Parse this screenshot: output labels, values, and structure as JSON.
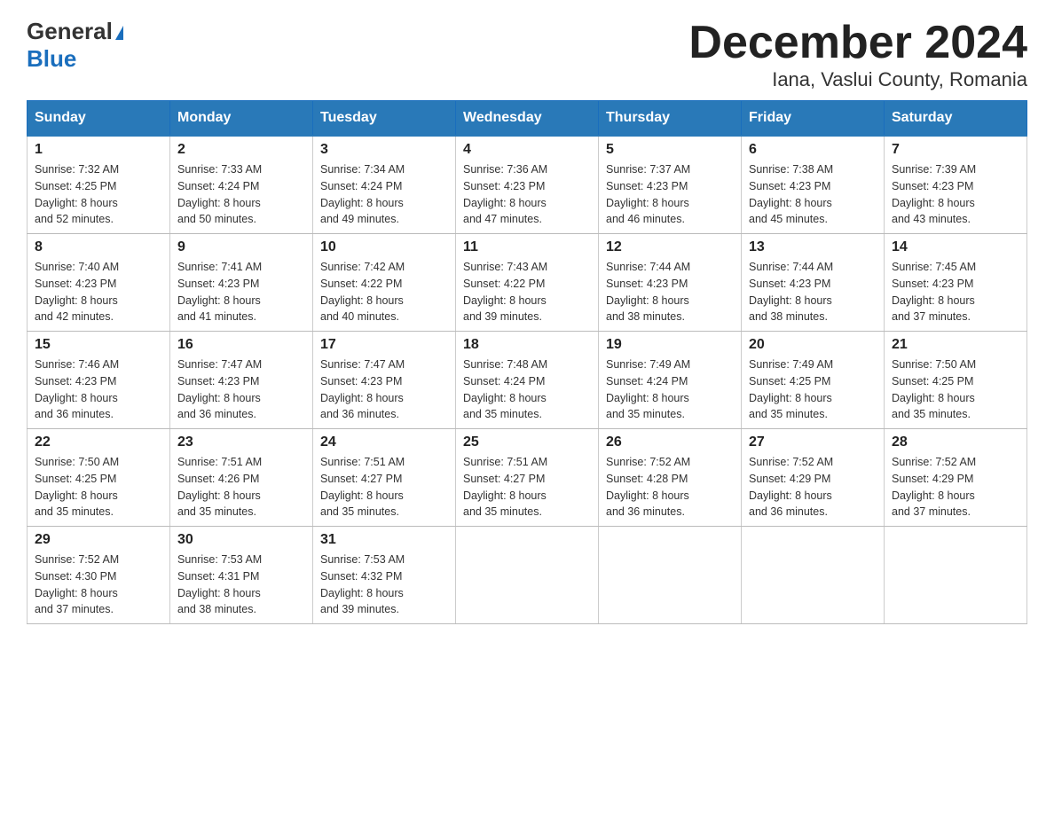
{
  "logo": {
    "line1": "General",
    "triangle": true,
    "line2": "Blue"
  },
  "title": "December 2024",
  "subtitle": "Iana, Vaslui County, Romania",
  "days_of_week": [
    "Sunday",
    "Monday",
    "Tuesday",
    "Wednesday",
    "Thursday",
    "Friday",
    "Saturday"
  ],
  "weeks": [
    [
      {
        "day": "1",
        "sunrise": "7:32 AM",
        "sunset": "4:25 PM",
        "daylight": "8 hours and 52 minutes."
      },
      {
        "day": "2",
        "sunrise": "7:33 AM",
        "sunset": "4:24 PM",
        "daylight": "8 hours and 50 minutes."
      },
      {
        "day": "3",
        "sunrise": "7:34 AM",
        "sunset": "4:24 PM",
        "daylight": "8 hours and 49 minutes."
      },
      {
        "day": "4",
        "sunrise": "7:36 AM",
        "sunset": "4:23 PM",
        "daylight": "8 hours and 47 minutes."
      },
      {
        "day": "5",
        "sunrise": "7:37 AM",
        "sunset": "4:23 PM",
        "daylight": "8 hours and 46 minutes."
      },
      {
        "day": "6",
        "sunrise": "7:38 AM",
        "sunset": "4:23 PM",
        "daylight": "8 hours and 45 minutes."
      },
      {
        "day": "7",
        "sunrise": "7:39 AM",
        "sunset": "4:23 PM",
        "daylight": "8 hours and 43 minutes."
      }
    ],
    [
      {
        "day": "8",
        "sunrise": "7:40 AM",
        "sunset": "4:23 PM",
        "daylight": "8 hours and 42 minutes."
      },
      {
        "day": "9",
        "sunrise": "7:41 AM",
        "sunset": "4:23 PM",
        "daylight": "8 hours and 41 minutes."
      },
      {
        "day": "10",
        "sunrise": "7:42 AM",
        "sunset": "4:22 PM",
        "daylight": "8 hours and 40 minutes."
      },
      {
        "day": "11",
        "sunrise": "7:43 AM",
        "sunset": "4:22 PM",
        "daylight": "8 hours and 39 minutes."
      },
      {
        "day": "12",
        "sunrise": "7:44 AM",
        "sunset": "4:23 PM",
        "daylight": "8 hours and 38 minutes."
      },
      {
        "day": "13",
        "sunrise": "7:44 AM",
        "sunset": "4:23 PM",
        "daylight": "8 hours and 38 minutes."
      },
      {
        "day": "14",
        "sunrise": "7:45 AM",
        "sunset": "4:23 PM",
        "daylight": "8 hours and 37 minutes."
      }
    ],
    [
      {
        "day": "15",
        "sunrise": "7:46 AM",
        "sunset": "4:23 PM",
        "daylight": "8 hours and 36 minutes."
      },
      {
        "day": "16",
        "sunrise": "7:47 AM",
        "sunset": "4:23 PM",
        "daylight": "8 hours and 36 minutes."
      },
      {
        "day": "17",
        "sunrise": "7:47 AM",
        "sunset": "4:23 PM",
        "daylight": "8 hours and 36 minutes."
      },
      {
        "day": "18",
        "sunrise": "7:48 AM",
        "sunset": "4:24 PM",
        "daylight": "8 hours and 35 minutes."
      },
      {
        "day": "19",
        "sunrise": "7:49 AM",
        "sunset": "4:24 PM",
        "daylight": "8 hours and 35 minutes."
      },
      {
        "day": "20",
        "sunrise": "7:49 AM",
        "sunset": "4:25 PM",
        "daylight": "8 hours and 35 minutes."
      },
      {
        "day": "21",
        "sunrise": "7:50 AM",
        "sunset": "4:25 PM",
        "daylight": "8 hours and 35 minutes."
      }
    ],
    [
      {
        "day": "22",
        "sunrise": "7:50 AM",
        "sunset": "4:25 PM",
        "daylight": "8 hours and 35 minutes."
      },
      {
        "day": "23",
        "sunrise": "7:51 AM",
        "sunset": "4:26 PM",
        "daylight": "8 hours and 35 minutes."
      },
      {
        "day": "24",
        "sunrise": "7:51 AM",
        "sunset": "4:27 PM",
        "daylight": "8 hours and 35 minutes."
      },
      {
        "day": "25",
        "sunrise": "7:51 AM",
        "sunset": "4:27 PM",
        "daylight": "8 hours and 35 minutes."
      },
      {
        "day": "26",
        "sunrise": "7:52 AM",
        "sunset": "4:28 PM",
        "daylight": "8 hours and 36 minutes."
      },
      {
        "day": "27",
        "sunrise": "7:52 AM",
        "sunset": "4:29 PM",
        "daylight": "8 hours and 36 minutes."
      },
      {
        "day": "28",
        "sunrise": "7:52 AM",
        "sunset": "4:29 PM",
        "daylight": "8 hours and 37 minutes."
      }
    ],
    [
      {
        "day": "29",
        "sunrise": "7:52 AM",
        "sunset": "4:30 PM",
        "daylight": "8 hours and 37 minutes."
      },
      {
        "day": "30",
        "sunrise": "7:53 AM",
        "sunset": "4:31 PM",
        "daylight": "8 hours and 38 minutes."
      },
      {
        "day": "31",
        "sunrise": "7:53 AM",
        "sunset": "4:32 PM",
        "daylight": "8 hours and 39 minutes."
      },
      null,
      null,
      null,
      null
    ]
  ],
  "colors": {
    "header_bg": "#2979b8",
    "header_text": "#ffffff",
    "border": "#bbbbbb",
    "accent_blue": "#1a6ebd"
  }
}
